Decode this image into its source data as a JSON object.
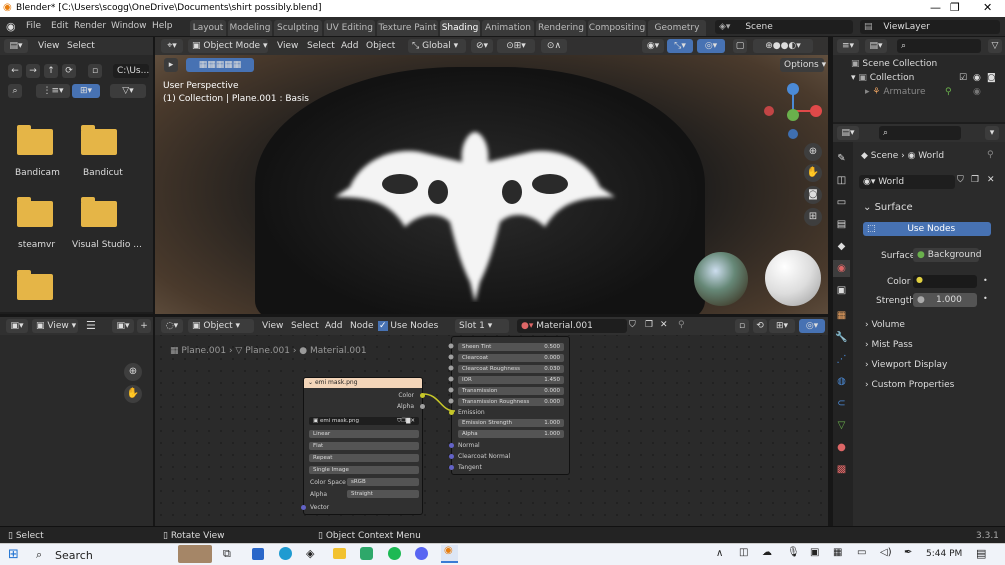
{
  "window": {
    "title": "Blender* [C:\\Users\\scogg\\OneDrive\\Documents\\shirt possibly.blend]"
  },
  "menu": {
    "file": "File",
    "edit": "Edit",
    "render": "Render",
    "window": "Window",
    "help": "Help"
  },
  "workspaces": [
    "Layout",
    "Modeling",
    "Sculpting",
    "UV Editing",
    "Texture Paint",
    "Shading",
    "Animation",
    "Rendering",
    "Compositing",
    "Geometry Noc"
  ],
  "scene_name": "Scene",
  "view_layer": "ViewLayer",
  "file_browser": {
    "view": "View",
    "select": "Select",
    "path": "C:\\Us...",
    "folders": [
      "Bandicam",
      "Bandicut",
      "steamvr",
      "Visual Studio ...",
      ""
    ]
  },
  "viewport": {
    "mode": "Object Mode",
    "view": "View",
    "select": "Select",
    "add": "Add",
    "object": "Object",
    "orientation": "Global",
    "options": "Options",
    "perspective": "User Perspective",
    "context": "(1) Collection | Plane.001 : Basis"
  },
  "outliner": {
    "scene_collection": "Scene Collection",
    "collection": "Collection",
    "armature": "Armature"
  },
  "properties": {
    "breadcrumb_scene": "Scene",
    "breadcrumb_world": "World",
    "world_name": "World",
    "surface_header": "Surface",
    "use_nodes": "Use Nodes",
    "surface_label": "Surface",
    "surface_value": "Background",
    "color_label": "Color",
    "strength_label": "Strength",
    "strength_value": "1.000",
    "panels": [
      "Volume",
      "Mist Pass",
      "Viewport Display",
      "Custom Properties"
    ]
  },
  "image_editor": {
    "view": "View"
  },
  "node_editor": {
    "object": "Object",
    "view": "View",
    "select": "Select",
    "add": "Add",
    "node": "Node",
    "use_nodes": "Use Nodes",
    "slot": "Slot 1",
    "material": "Material.001",
    "crumbs": [
      "Plane.001",
      "Plane.001",
      "Material.001"
    ]
  },
  "image_node": {
    "title": "emi mask.png",
    "out_color": "Color",
    "out_alpha": "Alpha",
    "image": "emi mask.png",
    "interp": "Linear",
    "proj": "Flat",
    "ext": "Repeat",
    "source": "Single Image",
    "cs_label": "Color Space",
    "cs_value": "sRGB",
    "alpha_label": "Alpha",
    "alpha_value": "Straight",
    "vector": "Vector"
  },
  "bsdf_node": {
    "rows": [
      {
        "label": "Sheen Tint",
        "value": "0.500"
      },
      {
        "label": "Clearcoat",
        "value": "0.000"
      },
      {
        "label": "Clearcoat Roughness",
        "value": "0.030"
      },
      {
        "label": "IOR",
        "value": "1.450"
      },
      {
        "label": "Transmission",
        "value": "0.000"
      },
      {
        "label": "Transmission Roughness",
        "value": "0.000"
      }
    ],
    "emission": "Emission",
    "emission_strength": {
      "label": "Emission Strength",
      "value": "1.000"
    },
    "alpha": {
      "label": "Alpha",
      "value": "1.000"
    },
    "normal": "Normal",
    "clearcoat_normal": "Clearcoat Normal",
    "tangent": "Tangent"
  },
  "statusbar": {
    "select": "Select",
    "rotate": "Rotate View",
    "context_menu": "Object Context Menu",
    "version": "3.3.1"
  },
  "taskbar": {
    "search": "Search",
    "time": "5:44 PM"
  },
  "colors": {
    "accent": "#4772b3",
    "folder": "#e5b547",
    "node_header_image": "#f3d5b9",
    "emission_link": "#c7c729"
  }
}
